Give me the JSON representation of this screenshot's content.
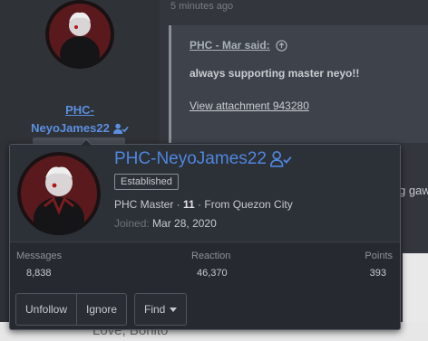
{
  "post": {
    "time": "5 minutes ago",
    "username_line1": "PHC-",
    "username_line2": "NeyoJames22",
    "quote_author": "PHC - Mar said:",
    "quote_text": "always supporting master neyo!!",
    "attachment_link": "View attachment 943280",
    "partial_text": "g gaw",
    "signature": "Love, Bonito"
  },
  "card": {
    "name": "PHC-NeyoJames22",
    "badge": "Established",
    "info_title": "PHC Master",
    "info_sep1": " · ",
    "info_level": "11",
    "info_rest": " · From Quezon City",
    "joined_label": "Joined:",
    "joined_date": "Mar 28, 2020",
    "stats": {
      "messages_label": "Messages",
      "messages_value": "8,838",
      "reaction_label": "Reaction",
      "reaction_value": "46,370",
      "points_label": "Points",
      "points_value": "393"
    },
    "buttons": {
      "unfollow": "Unfollow",
      "ignore": "Ignore",
      "find": "Find"
    }
  },
  "colors": {
    "username_blue": "#4f86df",
    "card_bg": "#262a30"
  },
  "icons": [
    "follow-user-icon",
    "quote-arrow-icon",
    "caret-down-icon",
    "avatar"
  ]
}
